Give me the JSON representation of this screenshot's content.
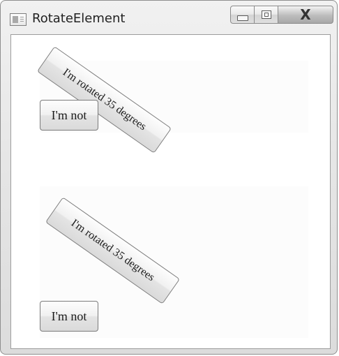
{
  "window": {
    "title": "RotateElement"
  },
  "titlebar_buttons": [
    {
      "name": "minimize",
      "icon": "minimize-icon"
    },
    {
      "name": "maximize",
      "icon": "maximize-icon"
    },
    {
      "name": "close",
      "icon": "close-icon",
      "label": "X"
    }
  ],
  "content": {
    "top": {
      "rotated_button_label": "I'm rotated 35 degrees",
      "plain_button_label": "I'm not"
    },
    "bottom": {
      "rotated_button_label": "I'm rotated 35 degrees",
      "plain_button_label": "I'm not"
    }
  },
  "colors": {
    "window_chrome": "#e4e4e4",
    "client_background": "#ffffff",
    "button_border": "#7b7b7b"
  }
}
